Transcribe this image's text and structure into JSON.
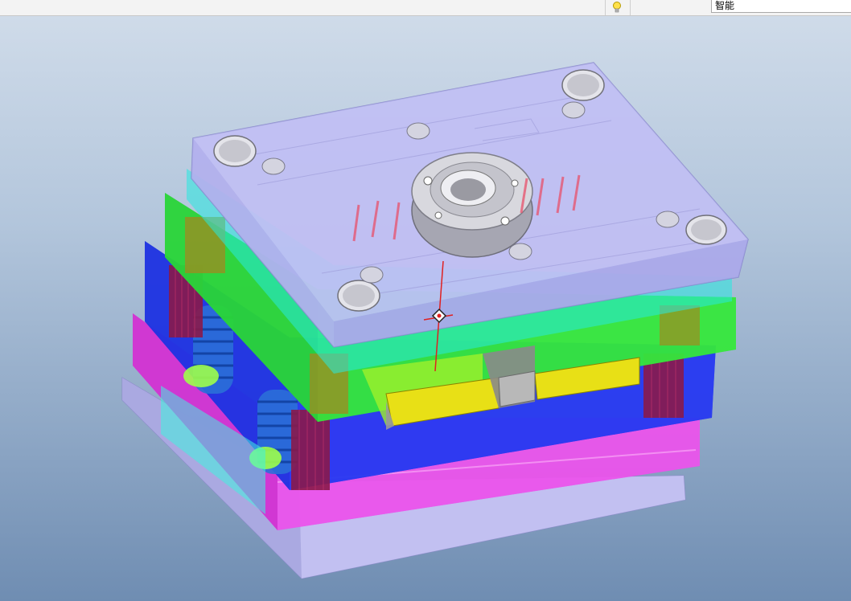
{
  "toolbar": {
    "filter_value": "智能",
    "hint_icon": "lightbulb-icon"
  },
  "viewport": {
    "model": "mold-assembly",
    "background_top": "#cfdbe9",
    "background_bottom": "#6f8db2"
  }
}
